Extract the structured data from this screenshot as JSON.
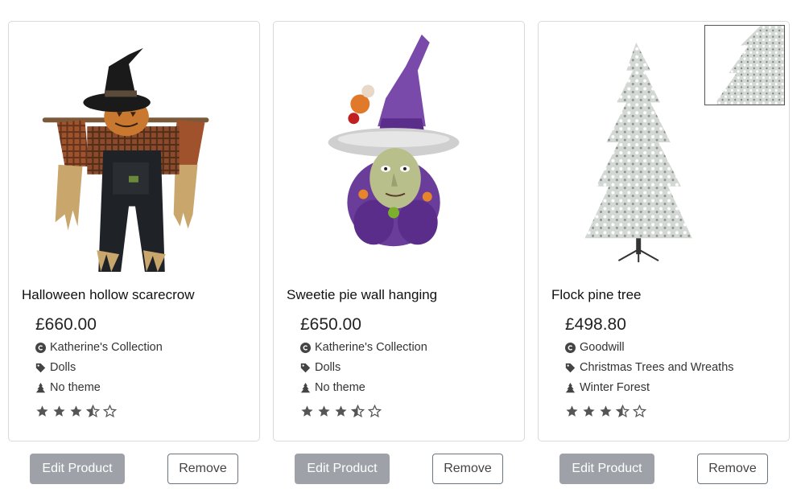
{
  "products": [
    {
      "title": "Halloween hollow scarecrow",
      "price": "£660.00",
      "brand": "Katherine's Collection",
      "category": "Dolls",
      "theme": "No theme",
      "rating": 3.5,
      "image_icon": "scarecrow-image",
      "edit_label": "Edit Product",
      "remove_label": "Remove"
    },
    {
      "title": "Sweetie pie wall hanging",
      "price": "£650.00",
      "brand": "Katherine's Collection",
      "category": "Dolls",
      "theme": "No theme",
      "rating": 3.5,
      "image_icon": "witch-image",
      "edit_label": "Edit Product",
      "remove_label": "Remove"
    },
    {
      "title": "Flock pine tree",
      "price": "£498.80",
      "brand": "Goodwill",
      "category": "Christmas Trees and Wreaths",
      "theme": "Winter Forest",
      "rating": 3.5,
      "image_icon": "flocked-tree-image",
      "edit_label": "Edit Product",
      "remove_label": "Remove"
    }
  ],
  "colors": {
    "edit_button_bg": "#9ea2a8",
    "remove_border": "#6c757d",
    "star": "#555555"
  }
}
